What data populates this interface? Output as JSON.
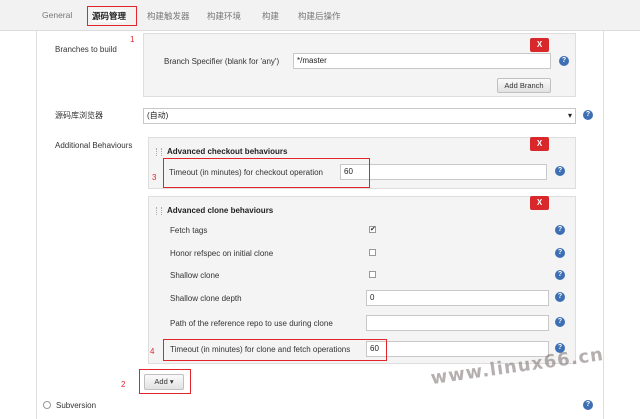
{
  "tabs": [
    {
      "label": "General"
    },
    {
      "label": "源码管理"
    },
    {
      "label": "构建触发器"
    },
    {
      "label": "构建环境"
    },
    {
      "label": "构建"
    },
    {
      "label": "构建后操作"
    }
  ],
  "annotations": {
    "n1": "1",
    "n2": "2",
    "n3": "3",
    "n4": "4"
  },
  "branches": {
    "section_label": "Branches to build",
    "specifier_label": "Branch Specifier (blank for 'any')",
    "specifier_value": "*/master",
    "add_branch": "Add Branch",
    "delete": "X"
  },
  "browser": {
    "label": "源码库浏览器",
    "value": "(自动)"
  },
  "behaviours": {
    "label": "Additional Behaviours",
    "checkout": {
      "title": "Advanced checkout behaviours",
      "timeout_label": "Timeout (in minutes) for checkout operation",
      "timeout_value": "60",
      "delete": "X"
    },
    "clone": {
      "title": "Advanced clone behaviours",
      "delete": "X",
      "fetch_tags_label": "Fetch tags",
      "fetch_tags_checked": true,
      "honor_refspec_label": "Honor refspec on initial clone",
      "honor_refspec_checked": false,
      "shallow_clone_label": "Shallow clone",
      "shallow_clone_checked": false,
      "shallow_depth_label": "Shallow clone depth",
      "shallow_depth_value": "0",
      "reference_repo_label": "Path of the reference repo to use during clone",
      "reference_repo_value": "",
      "timeout_label": "Timeout (in minutes) for clone and fetch operations",
      "timeout_value": "60"
    },
    "add_button": "Add"
  },
  "subversion": {
    "label": "Subversion"
  },
  "watermark": "www.linux66.cn",
  "colors": {
    "highlight": "#e0262b",
    "delete_button": "#d9282c",
    "help_icon": "#3d6fb5"
  }
}
